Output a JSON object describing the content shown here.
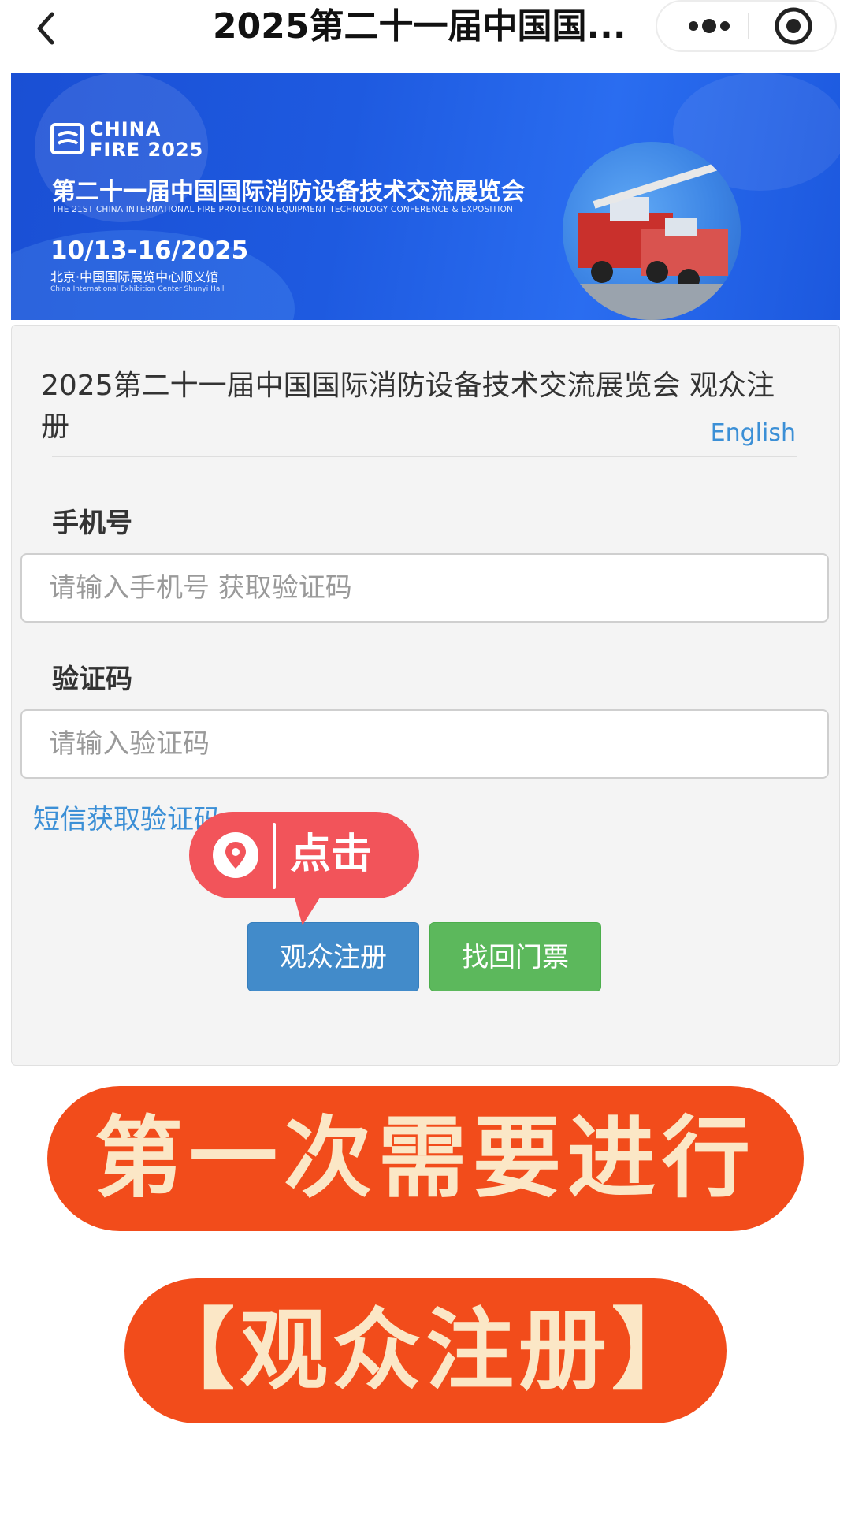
{
  "nav": {
    "title": "2025第二十一届中国国...",
    "back_icon": "chevron-left-icon",
    "more_icon": "more-dots-icon",
    "close_icon": "target-circle-icon"
  },
  "banner": {
    "logo_line1": "CHINA",
    "logo_line2": "FIRE 2025",
    "title_cn": "第二十一届中国国际消防设备技术交流展览会",
    "title_en": "THE 21ST CHINA INTERNATIONAL FIRE PROTECTION EQUIPMENT TECHNOLOGY CONFERENCE & EXPOSITION",
    "dates": "10/13-16/2025",
    "venue_cn": "北京·中国国际展览中心顺义馆",
    "venue_en": "China International Exhibition Center Shunyi Hall",
    "photo_description": "fire-truck-photo"
  },
  "form": {
    "title": "2025第二十一届中国国际消防设备技术交流展览会 观众注册",
    "language_link": "English",
    "phone_label": "手机号",
    "phone_placeholder": "请输入手机号 获取验证码",
    "code_label": "验证码",
    "code_placeholder": "请输入验证码",
    "sms_link": "短信获取验证码",
    "register_button": "观众注册",
    "ticket_button": "找回门票"
  },
  "callout": {
    "text": "点击",
    "icon": "location-pin-icon"
  },
  "captions": {
    "line1": "第一次需要进行",
    "line2": "【观众注册】"
  },
  "colors": {
    "primary_button": "#428bca",
    "success_button": "#5cb85c",
    "link": "#3b8fd6",
    "callout": "#f2545a",
    "caption_bg": "#f24c1b",
    "caption_text": "#fbe7c6",
    "banner_blue": "#1e5ae0"
  }
}
